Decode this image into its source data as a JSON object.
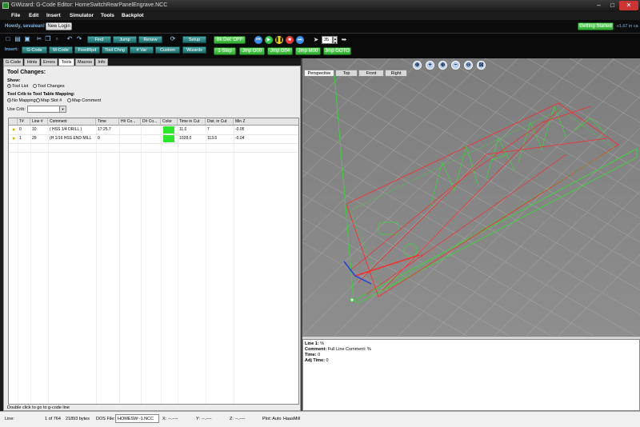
{
  "window": {
    "title": "GWizard: G-Code Editor: HomeSwitchRearPanelEngrave.NCC"
  },
  "menu": [
    "File",
    "Edit",
    "Insert",
    "Simulator",
    "Tools",
    "Backplot"
  ],
  "login": {
    "greeting": "Howdy, sevalean!",
    "new_login": "New Login",
    "getting_started": "Getting Started",
    "version": "v1.67 in ca"
  },
  "toolbar": {
    "row1": [
      "Find",
      "Jump",
      "Renew",
      "Setup"
    ],
    "insert_label": "Insert:",
    "row2": [
      "G-Code",
      "M-Code",
      "FeedRpd",
      "Tool Chng",
      "# Var",
      "Custom",
      "Wizards"
    ],
    "bk_off": "Bk Del: OFF",
    "step": "1 Step",
    "jmp_buttons": [
      "Jmp G00",
      "Jmp G04",
      "Jmp M00",
      "Jmp GOTO"
    ],
    "speed_value": "35"
  },
  "tabs": [
    "G-Code",
    "Hints",
    "Errors",
    "Tools",
    "Macros",
    "Info"
  ],
  "active_tab": "Tools",
  "tools": {
    "heading": "Tool Changes:",
    "show_label": "Show:",
    "show_options": [
      "Tool List",
      "Tool Changes"
    ],
    "crib_label": "Tool Crib to Tool Table Mapping:",
    "crib_options": [
      "No Mapping",
      "Map Slot #",
      "Map Comment"
    ],
    "use_crib_label": "Use Crib:",
    "use_crib_value": "",
    "columns": [
      "",
      "T#",
      "Line #",
      "Comment",
      "Time",
      "H# Co...",
      "D# Co...",
      "Color",
      "Time in Cut",
      "Dist. in Cut",
      "Min Z"
    ],
    "rows": [
      {
        "t": "0",
        "line": "10",
        "comment": "( HSS 1/4 DRILL   )",
        "time": "17:25.7",
        "h": "",
        "d": "",
        "color": "#2ee62e",
        "time_cut": "11.0",
        "dist_cut": "7",
        "minz": "-0.05"
      },
      {
        "t": "1",
        "line": "29",
        "comment": "(H 1/16 HSS END MILL",
        "time": "0",
        "h": "",
        "d": "",
        "color": "#2ee62e",
        "time_cut": "1028.0",
        "dist_cut": "113.6",
        "minz": "-0.04"
      }
    ],
    "hint": "Double click to go to g-code line"
  },
  "viewport": {
    "view_tabs": [
      "Perspective",
      "Top",
      "Front",
      "Right"
    ],
    "active_view": "Perspective",
    "zoom_icons": [
      "zoom-fit-icon",
      "zoom-in-icon",
      "zoom-plus-icon",
      "zoom-minus-icon",
      "zoom-out-icon",
      "zoom-window-icon"
    ],
    "engrave_text": "MILL"
  },
  "info": [
    {
      "label": "Line 1:",
      "value": "%"
    },
    {
      "label": "Comment:",
      "value": "Full Line Comment: %"
    },
    {
      "label": "Time:",
      "value": "0"
    },
    {
      "label": "Adj Time:",
      "value": "0"
    }
  ],
  "status": {
    "line_label": "Line:",
    "line_of": "1 of 764",
    "bytes": "21893 bytes",
    "dos_label": "DOS File:",
    "dos_value": "HOMESW~1.NCC",
    "x_label": "X:",
    "x_value": "--.----",
    "y_label": "Y:",
    "y_value": "--.----",
    "z_label": "Z:",
    "z_value": "--.----",
    "plot": "Plot: Auto",
    "machine": "HaasMill"
  },
  "colors": {
    "accent_green": "#2fa82f",
    "toolpath_red": "#ff2a2a",
    "toolpath_green": "#3cd23c",
    "grid": "#bdbdbd",
    "info_blue": "#7db7e8"
  }
}
